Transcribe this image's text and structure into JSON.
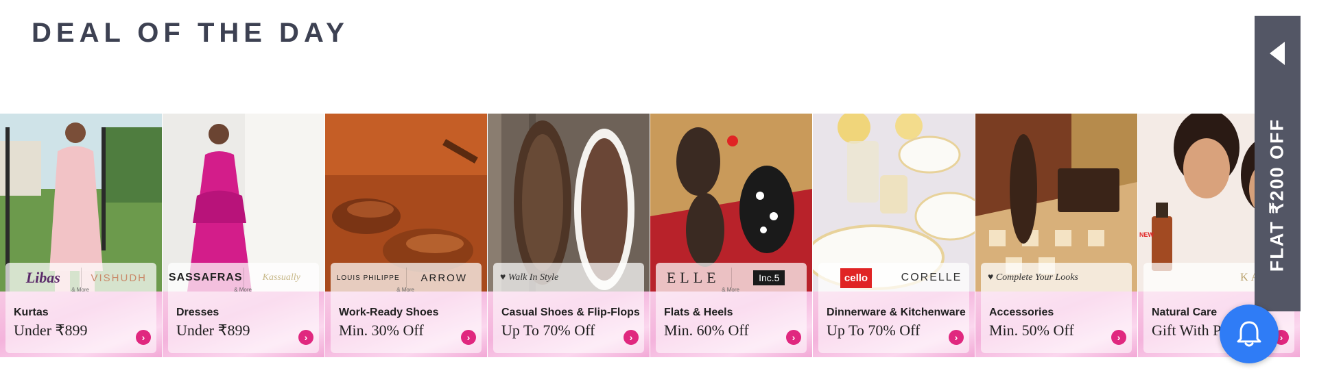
{
  "section": {
    "title": "DEAL OF THE DAY"
  },
  "side_tab": {
    "text": "FLAT ₹200 OFF",
    "icon": "chevron-left-icon"
  },
  "notification": {
    "icon": "bell-icon"
  },
  "colors": {
    "accent": "#e0287f",
    "tab_bg": "#535665",
    "title": "#3d4152",
    "bell": "#2f7cf6"
  },
  "cards": [
    {
      "category": "Kurtas",
      "offer": "Under ₹899",
      "brands": [
        "Libas",
        "VISHUDH"
      ],
      "more": "& More",
      "arrow_icon": "chevron-right-icon"
    },
    {
      "category": "Dresses",
      "offer": "Under ₹899",
      "brands": [
        "SASSAFRAS",
        "Kassually"
      ],
      "more": "& More",
      "arrow_icon": "chevron-right-icon"
    },
    {
      "category": "Work-Ready Shoes",
      "offer": "Min. 30% Off",
      "brands": [
        "LOUIS PHILIPPE",
        "ARROW"
      ],
      "more": "& More",
      "arrow_icon": "chevron-right-icon"
    },
    {
      "category": "Casual Shoes & Flip-Flops",
      "offer": "Up To 70% Off",
      "brands": [
        "Walk In Style"
      ],
      "more": "",
      "arrow_icon": "chevron-right-icon"
    },
    {
      "category": "Flats & Heels",
      "offer": "Min. 60% Off",
      "brands": [
        "ELLE",
        "Inc.5"
      ],
      "more": "& More",
      "arrow_icon": "chevron-right-icon"
    },
    {
      "category": "Dinnerware & Kitchenware",
      "offer": "Up To 70% Off",
      "brands": [
        "cello",
        "CORELLE"
      ],
      "more": "",
      "arrow_icon": "chevron-right-icon"
    },
    {
      "category": "Accessories",
      "offer": "Min. 50% Off",
      "brands": [
        "Complete Your Looks"
      ],
      "more": "",
      "arrow_icon": "chevron-right-icon"
    },
    {
      "category": "Natural Care",
      "offer": "Gift With Purchase",
      "brands": [
        "KAMA"
      ],
      "more": "",
      "badge": "NEW",
      "arrow_icon": "chevron-right-icon"
    }
  ]
}
